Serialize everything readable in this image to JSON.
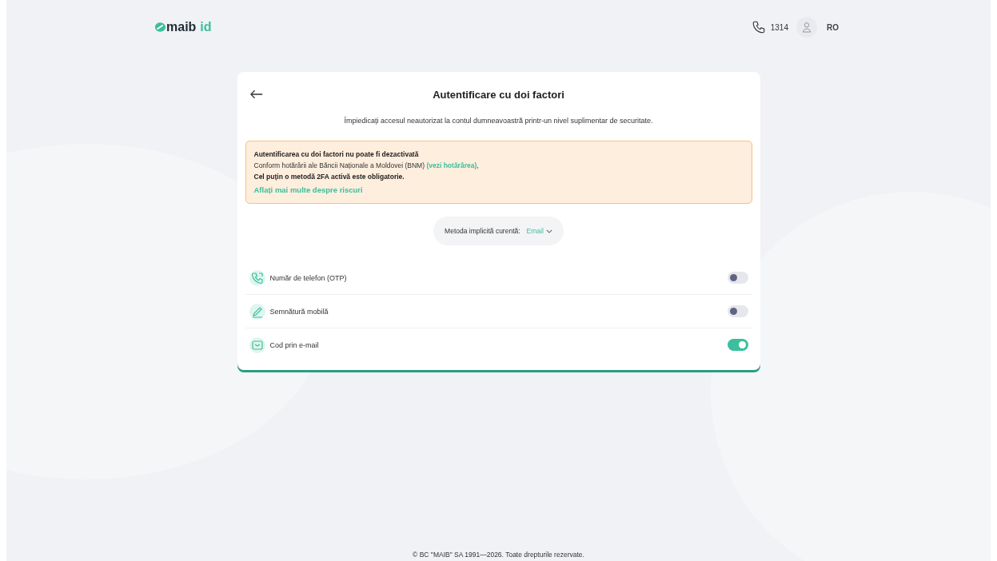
{
  "header": {
    "logo": {
      "text": "maib",
      "suffix": "id"
    },
    "phone": "1314",
    "language": "RO"
  },
  "card": {
    "title": "Autentificare cu doi factori",
    "subtitle": "Împiedicați accesul neautorizat la contul dumneavoastră printr-un nivel suplimentar de securitate.",
    "notice": {
      "title": "Autentificarea cu doi factori nu poate fi dezactivată",
      "text": "Conform hotărârii ale Băncii Naționale a Moldovei (BNM)",
      "link": "(vezi hotărârea)",
      "after": ",",
      "rule": "Cel puțin o metodă 2FA activă este obligatorie.",
      "more": "Aflați mai multe despre riscuri"
    },
    "default_method": {
      "label": "Metoda implicită curentă:",
      "value": "Email"
    },
    "methods": [
      {
        "kind": "phone",
        "label": "Număr de telefon (OTP)",
        "on": false
      },
      {
        "kind": "signature",
        "label": "Semnătură mobilă",
        "on": false
      },
      {
        "kind": "email",
        "label": "Cod prin e-mail",
        "on": true
      }
    ]
  },
  "footer": "© BC \"MAIB\" SA 1991—2026. Toate drepturile rezervate."
}
